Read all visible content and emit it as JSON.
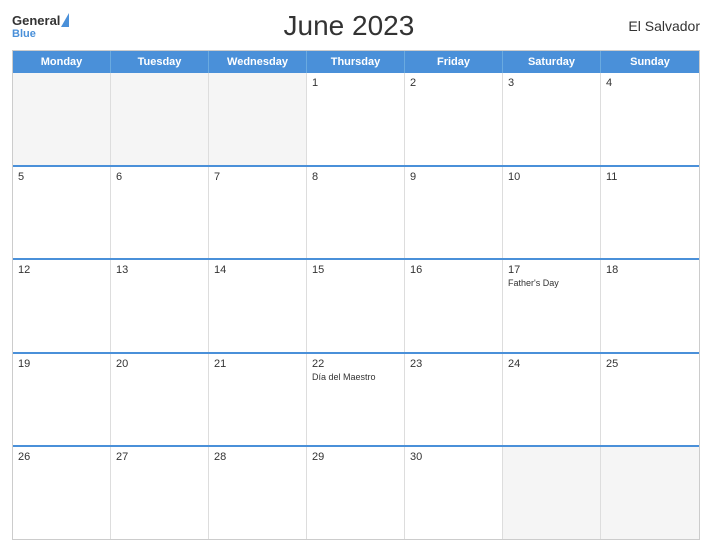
{
  "header": {
    "title": "June 2023",
    "country": "El Salvador",
    "logo_general": "General",
    "logo_blue": "Blue"
  },
  "days_of_week": [
    "Monday",
    "Tuesday",
    "Wednesday",
    "Thursday",
    "Friday",
    "Saturday",
    "Sunday"
  ],
  "weeks": [
    [
      {
        "num": "",
        "empty": true
      },
      {
        "num": "",
        "empty": true
      },
      {
        "num": "",
        "empty": true
      },
      {
        "num": "1",
        "empty": false
      },
      {
        "num": "2",
        "empty": false
      },
      {
        "num": "3",
        "empty": false
      },
      {
        "num": "4",
        "empty": false
      }
    ],
    [
      {
        "num": "5",
        "empty": false
      },
      {
        "num": "6",
        "empty": false
      },
      {
        "num": "7",
        "empty": false
      },
      {
        "num": "8",
        "empty": false
      },
      {
        "num": "9",
        "empty": false
      },
      {
        "num": "10",
        "empty": false
      },
      {
        "num": "11",
        "empty": false
      }
    ],
    [
      {
        "num": "12",
        "empty": false
      },
      {
        "num": "13",
        "empty": false
      },
      {
        "num": "14",
        "empty": false
      },
      {
        "num": "15",
        "empty": false
      },
      {
        "num": "16",
        "empty": false
      },
      {
        "num": "17",
        "empty": false,
        "holiday": "Father's Day"
      },
      {
        "num": "18",
        "empty": false
      }
    ],
    [
      {
        "num": "19",
        "empty": false
      },
      {
        "num": "20",
        "empty": false
      },
      {
        "num": "21",
        "empty": false
      },
      {
        "num": "22",
        "empty": false,
        "holiday": "Día del Maestro"
      },
      {
        "num": "23",
        "empty": false
      },
      {
        "num": "24",
        "empty": false
      },
      {
        "num": "25",
        "empty": false
      }
    ],
    [
      {
        "num": "26",
        "empty": false
      },
      {
        "num": "27",
        "empty": false
      },
      {
        "num": "28",
        "empty": false
      },
      {
        "num": "29",
        "empty": false
      },
      {
        "num": "30",
        "empty": false
      },
      {
        "num": "",
        "empty": true
      },
      {
        "num": "",
        "empty": true
      }
    ]
  ]
}
